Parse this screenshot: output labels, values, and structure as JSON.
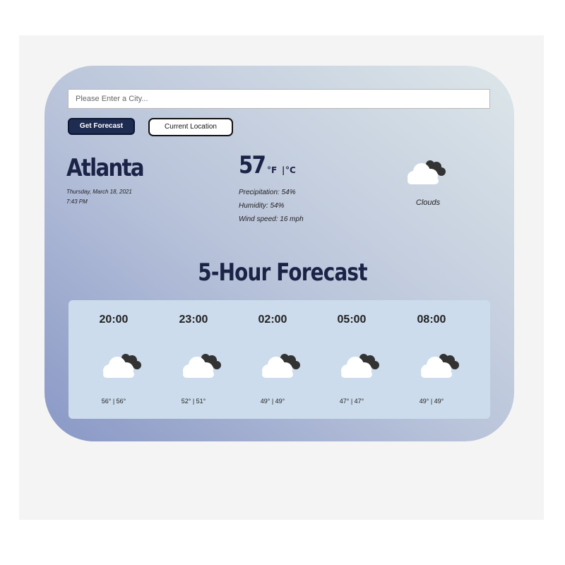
{
  "search": {
    "placeholder": "Please Enter a City...",
    "value": ""
  },
  "buttons": {
    "get_forecast": "Get Forecast",
    "current_location": "Current Location"
  },
  "current": {
    "city": "Atlanta",
    "date": "Thursday, March 18, 2021",
    "time": "7:43 PM",
    "temperature": "57",
    "unit_f": "°F",
    "unit_separator": "|",
    "unit_c": "°C",
    "precipitation": "Precipitation: 54%",
    "humidity": "Humidity: 54%",
    "wind": "Wind speed: 16 mph",
    "condition": "Clouds",
    "icon": "cloudy-icon"
  },
  "forecast": {
    "heading": "5-Hour Forecast",
    "hours": [
      {
        "time": "20:00",
        "temps": "56° | 56°",
        "icon": "cloudy-icon"
      },
      {
        "time": "23:00",
        "temps": "52° | 51°",
        "icon": "cloudy-icon"
      },
      {
        "time": "02:00",
        "temps": "49° | 49°",
        "icon": "cloudy-icon"
      },
      {
        "time": "05:00",
        "temps": "47° | 47°",
        "icon": "cloudy-icon"
      },
      {
        "time": "08:00",
        "temps": "49° | 49°",
        "icon": "cloudy-icon"
      }
    ]
  },
  "colors": {
    "heading": "#1b2447",
    "button_primary": "#1f2c52",
    "panel": "#ccdcec",
    "card_gradient_start": "#8998c6",
    "card_gradient_end": "#dde6e9"
  }
}
